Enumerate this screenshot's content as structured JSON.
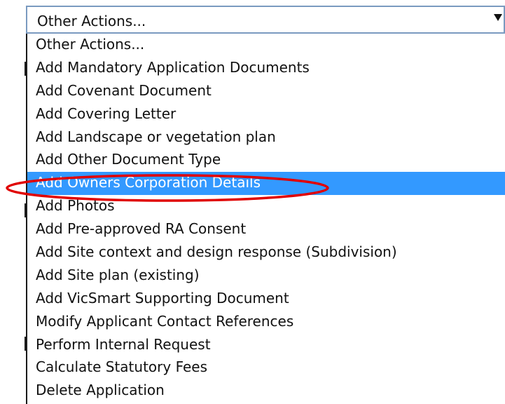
{
  "dropdown": {
    "selected_value": "Other Actions...",
    "options": [
      {
        "label": "Other Actions..."
      },
      {
        "label": "Add Mandatory Application Documents"
      },
      {
        "label": "Add Covenant Document"
      },
      {
        "label": "Add Covering Letter"
      },
      {
        "label": "Add Landscape or vegetation plan"
      },
      {
        "label": "Add Other Document Type"
      },
      {
        "label": "Add Owners Corporation Details",
        "highlighted": true
      },
      {
        "label": "Add Photos"
      },
      {
        "label": "Add Pre-approved RA Consent"
      },
      {
        "label": "Add Site context and design response (Subdivision)"
      },
      {
        "label": "Add Site plan (existing)"
      },
      {
        "label": "Add VicSmart Supporting Document"
      },
      {
        "label": "Modify Applicant Contact References"
      },
      {
        "label": "Perform Internal Request"
      },
      {
        "label": "Calculate Statutory Fees"
      },
      {
        "label": "Delete Application"
      }
    ]
  },
  "colors": {
    "highlight_bg": "#3399ff",
    "annotation_ellipse": "#e00000",
    "select_border": "#7a9ac0"
  },
  "icons": {
    "dropdown_arrow": "triangle-down"
  }
}
